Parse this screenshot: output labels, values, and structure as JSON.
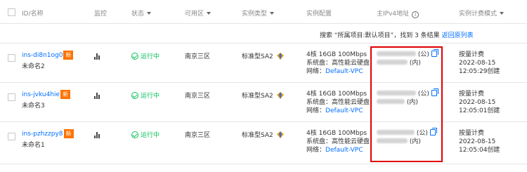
{
  "header": {
    "id_name": "ID/名称",
    "monitor": "监控",
    "status": "状态",
    "zone": "可用区",
    "instance_type": "实例类型",
    "instance_config": "实例配置",
    "primary_ipv4": "主IPv4地址",
    "billing_mode": "实例计费模式"
  },
  "search": {
    "result_text": "搜索 “所属项目:默认项目”，找到 3 条结果",
    "back_link": "返回原列表"
  },
  "rows": [
    {
      "id": "ins-di8n1og0",
      "new_badge": "新",
      "name": "未命名2",
      "status": "运行中",
      "zone": "南京三区",
      "type": "标准型SA2",
      "config_line1": "4核 16GB 100Mbps",
      "config_line2": "系统盘：高性能云硬盘",
      "config_net_label": "网络：",
      "config_net": "Default-VPC",
      "public_suffix": "(公)",
      "private_suffix": "(内)",
      "billing": "按量计费",
      "date": "2022-08-15",
      "created": "12:05:29创建"
    },
    {
      "id": "ins-jvku4hie",
      "new_badge": "新",
      "name": "未命名3",
      "status": "运行中",
      "zone": "南京三区",
      "type": "标准型SA2",
      "config_line1": "4核 16GB 100Mbps",
      "config_line2": "系统盘：高性能云硬盘",
      "config_net_label": "网络：",
      "config_net": "Default-VPC",
      "public_suffix": "(公)",
      "private_suffix": "(内)",
      "billing": "按量计费",
      "date": "2022-08-15",
      "created": "12:05:01创建"
    },
    {
      "id": "ins-pzhzzpy8",
      "new_badge": "新",
      "name": "未命名1",
      "status": "运行中",
      "zone": "南京三区",
      "type": "标准型SA2",
      "config_line1": "4核 16GB 100Mbps",
      "config_line2": "系统盘：高性能云硬盘",
      "config_net_label": "网络：",
      "config_net": "Default-VPC",
      "public_suffix": "(公)",
      "private_suffix": "(内)",
      "billing": "按量计费",
      "date": "2022-08-15",
      "created": "12:05:04创建"
    }
  ],
  "colors": {
    "link": "#006eff",
    "running": "#0abf5b",
    "new_badge": "#ff7200",
    "highlight": "#e00000"
  }
}
